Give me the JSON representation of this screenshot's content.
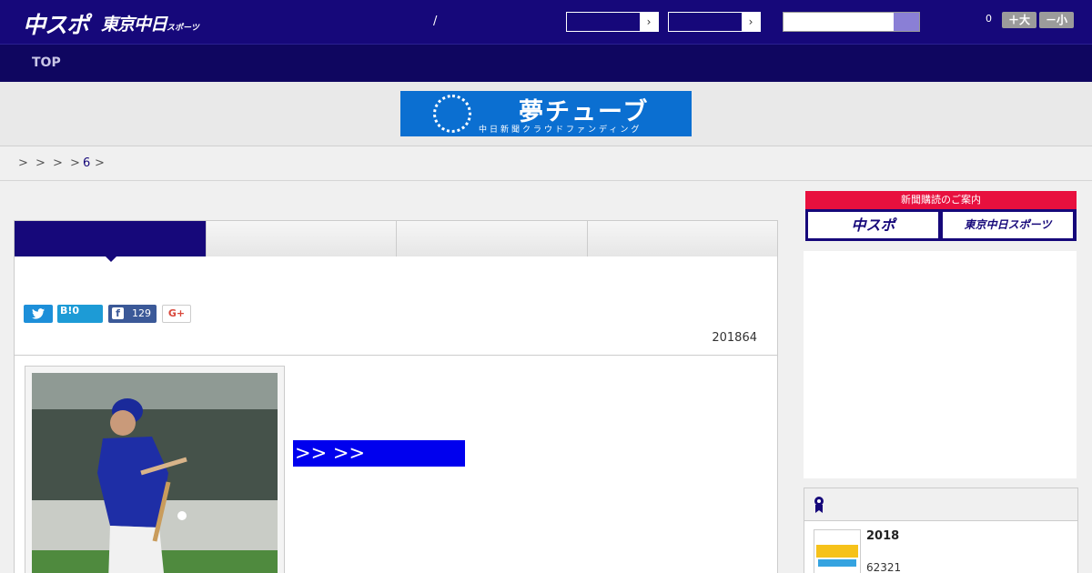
{
  "header": {
    "logo_main": "中スポ",
    "logo_sub": "東京中日",
    "logo_sub_small": "スポーツ",
    "slash": "/",
    "select1_arrow": "›",
    "select2_arrow": "›",
    "fontsize_count": "0",
    "fontsize_plus": "＋大",
    "fontsize_minus": "－小"
  },
  "nav": {
    "top": "TOP"
  },
  "banner": {
    "main": "夢チューブ",
    "sub": "中日新聞クラウドファンディング"
  },
  "breadcrumb": {
    "sep": ">",
    "link": "6"
  },
  "share": {
    "hatena": "B!0",
    "fb_icon": "f",
    "fb_count": "129",
    "gplus": "G+"
  },
  "article": {
    "date": "201864",
    "more_link": ">> >>"
  },
  "sidebar": {
    "subscribe_head": "新聞購読のご案内",
    "sub_btn1": "中スポ",
    "sub_btn2": "東京中日スポーツ",
    "item_title": "2018",
    "item_sub": "62321"
  }
}
